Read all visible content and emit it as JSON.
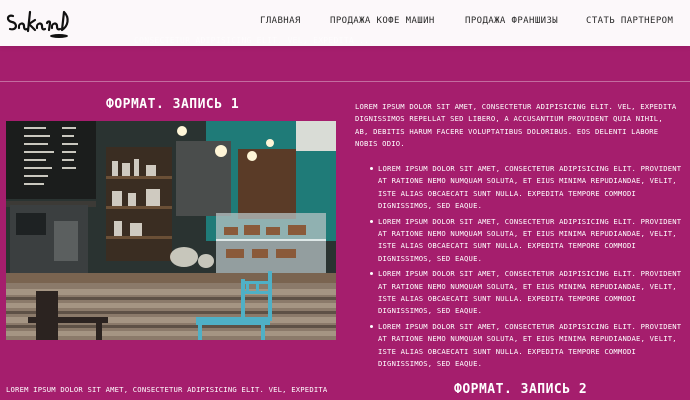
{
  "header": {
    "logo_name": "sakura-cafe-logo",
    "nav": [
      {
        "label": "Главная"
      },
      {
        "label": "Продажа кофе машин"
      },
      {
        "label": "Продажа франшизы"
      },
      {
        "label": "Стать партнером"
      }
    ]
  },
  "ghost_line": "consectetur adipisicing elit. vel, expedita ...",
  "section1": {
    "title": "Формат. Запись 1",
    "paragraph": "Lorem ipsum dolor sit amet, consectetur adipisicing elit. Vel, expedita dignissimos repellat sed libero, a accusantium provident quia nihil, ab, debitis harum facere voluptatibus doloribus. Eos delenti labore nobis odio.",
    "bullets": [
      "Lorem ipsum dolor sit amet, consectetur adipisicing elit. Provident at ratione nemo numquam soluta, et eius minima repudiandae, velit, iste alias obcaecati sunt nulla. Expedita tempore commodi dignissimos, sed eaque.",
      "Lorem ipsum dolor sit amet, consectetur adipisicing elit. Provident at ratione nemo numquam soluta, et eius minima repudiandae, velit, iste alias obcaecati sunt nulla. Expedita tempore commodi dignissimos, sed eaque.",
      "Lorem ipsum dolor sit amet, consectetur adipisicing elit. Provident at ratione nemo numquam soluta, et eius minima repudiandae, velit, iste alias obcaecati sunt nulla. Expedita tempore commodi dignissimos, sed eaque.",
      "Lorem ipsum dolor sit amet, consectetur adipisicing elit. Provident at ratione nemo numquam soluta, et eius minima repudiandae, velit, iste alias obcaecati sunt nulla. Expedita tempore commodi dignissimos, sed eaque."
    ]
  },
  "section2": {
    "title": "Формат. Запись 2",
    "paragraph": "Lorem ipsum dolor sit amet, consectetur adipisicing elit. Vel, expedita"
  },
  "colors": {
    "background": "#a51e6d",
    "header": "#ffffff",
    "text": "#ffffff"
  }
}
